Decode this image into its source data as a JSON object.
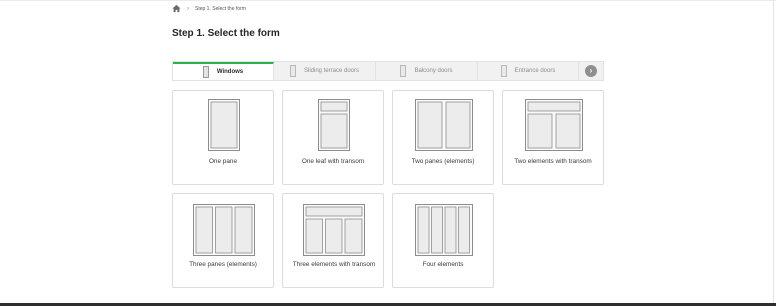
{
  "breadcrumb": {
    "home_icon": "home-icon",
    "separator": "›",
    "current": "Step 1. Select the form"
  },
  "page_title": "Step 1. Select the form",
  "tabs": [
    {
      "label": "Windows",
      "active": true
    },
    {
      "label": "Sliding terrace doors",
      "active": false
    },
    {
      "label": "Balcony doors",
      "active": false
    },
    {
      "label": "Entrance doors",
      "active": false
    }
  ],
  "tabs_next_icon": "chevron-right-icon",
  "colors": {
    "accent": "#2bb24c",
    "frame": "#8d8d8d",
    "glass": "#ececec"
  },
  "forms": [
    {
      "label": "One pane"
    },
    {
      "label": "One leaf with transom"
    },
    {
      "label": "Two panes (elements)"
    },
    {
      "label": "Two elements with transom"
    },
    {
      "label": "Three panes (elements)"
    },
    {
      "label": "Three elements with transom"
    },
    {
      "label": "Four elements"
    }
  ]
}
